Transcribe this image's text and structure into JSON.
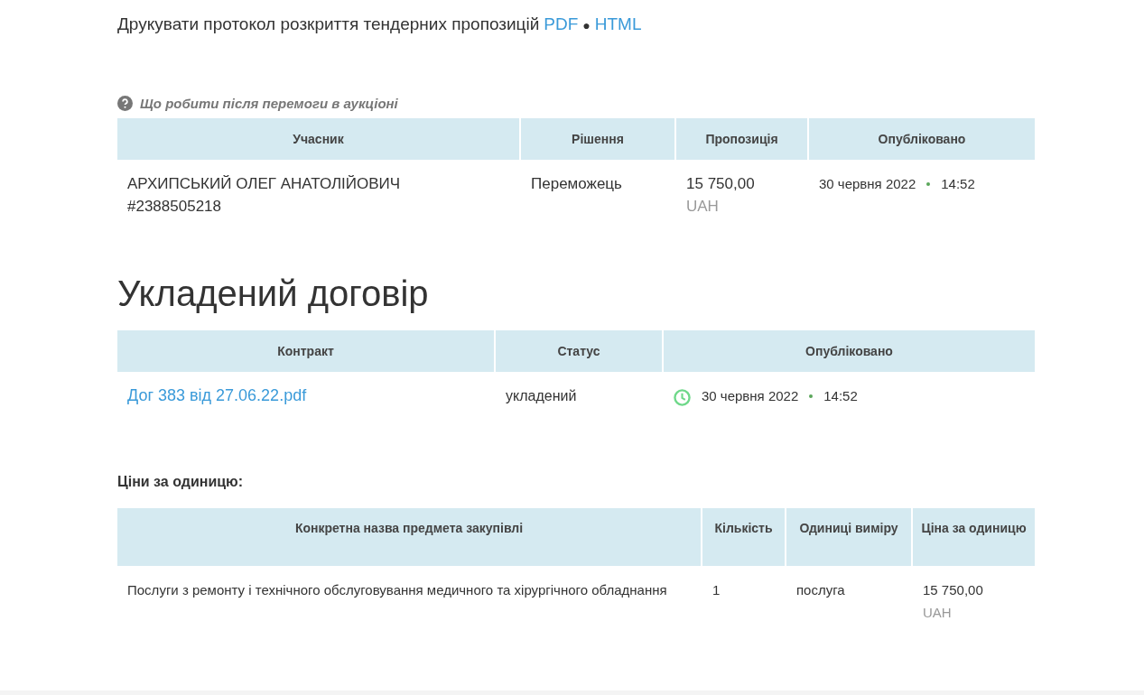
{
  "print_protocol": {
    "text": "Друкувати протокол розкриття тендерних пропозицій",
    "links": [
      "PDF",
      "HTML"
    ],
    "separator": "●"
  },
  "help_link": "Що робити після перемоги в аукціоні",
  "bids_table": {
    "columns": [
      "Учасник",
      "Рішення",
      "Пропозиція",
      "Опубліковано"
    ],
    "rows": [
      {
        "participant": "АРХИПСЬКИЙ ОЛЕГ АНАТОЛІЙОВИЧ",
        "participant_id": "#2388505218",
        "decision": "Переможець",
        "amount": "15 750,00",
        "currency": "UAH",
        "date": "30 червня 2022",
        "time": "14:52"
      }
    ]
  },
  "contract_section": {
    "title": "Укладений договір",
    "columns": [
      "Контракт",
      "Статус",
      "Опубліковано"
    ],
    "rows": [
      {
        "document": "Дог 383 від 27.06.22.pdf",
        "status": "укладений",
        "date": "30 червня 2022",
        "time": "14:52"
      }
    ]
  },
  "unit_prices": {
    "title": "Ціни за одиницю:",
    "columns": [
      "Конкретна назва предмета закупівлі",
      "Кількість",
      "Одиниці виміру",
      "Ціна за одиницю"
    ],
    "rows": [
      {
        "item": "Послуги з ремонту і технічного обслуговування медичного та хірургічного обладнання",
        "quantity": "1",
        "unit": "послуга",
        "price": "15 750,00",
        "currency": "UAH"
      }
    ]
  }
}
